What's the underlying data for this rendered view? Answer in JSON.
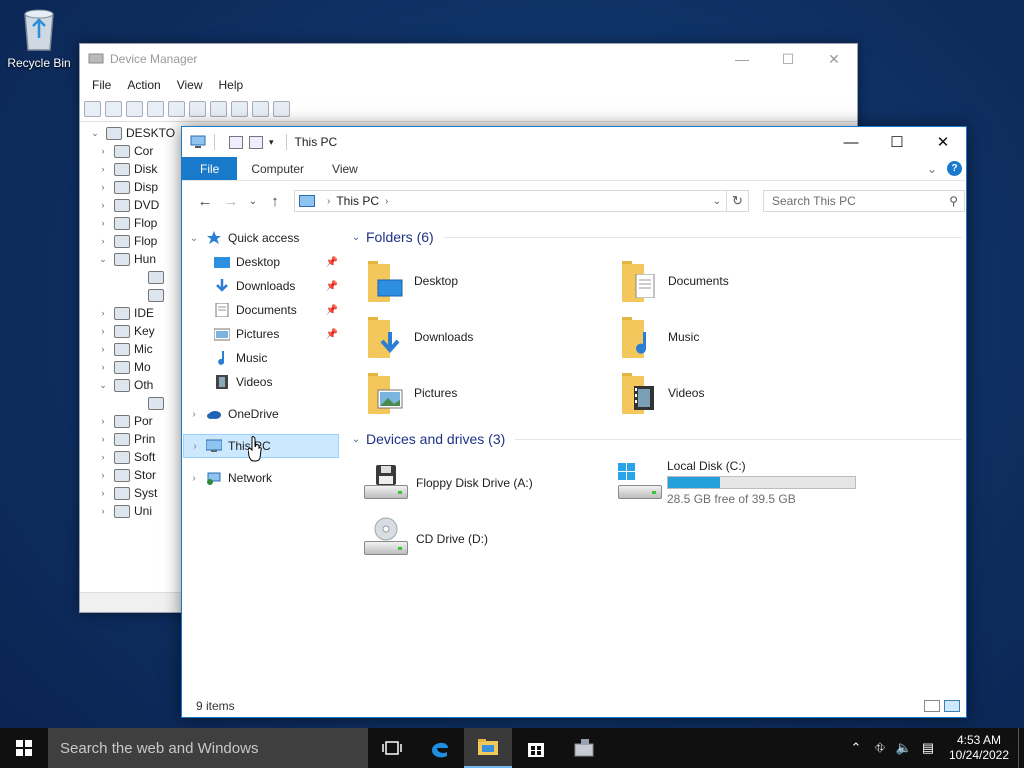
{
  "desktop": {
    "recycle_bin_label": "Recycle Bin"
  },
  "device_manager": {
    "title": "Device Manager",
    "menu": [
      "File",
      "Action",
      "View",
      "Help"
    ],
    "controls": {
      "minimize": "—",
      "maximize": "☐",
      "close": "✕"
    },
    "tree": [
      {
        "chev": "⌄",
        "label": "DESKTO"
      },
      {
        "chev": "›",
        "label": "Cor"
      },
      {
        "chev": "›",
        "label": "Disk"
      },
      {
        "chev": "›",
        "label": "Disp"
      },
      {
        "chev": "›",
        "label": "DVD"
      },
      {
        "chev": "›",
        "label": "Flop"
      },
      {
        "chev": "›",
        "label": "Flop"
      },
      {
        "chev": "⌄",
        "label": "Hun"
      },
      {
        "chev": "",
        "label": ""
      },
      {
        "chev": "",
        "label": ""
      },
      {
        "chev": "›",
        "label": "IDE"
      },
      {
        "chev": "›",
        "label": "Key"
      },
      {
        "chev": "›",
        "label": "Mic"
      },
      {
        "chev": "›",
        "label": "Mo"
      },
      {
        "chev": "⌄",
        "label": "Oth"
      },
      {
        "chev": "",
        "label": ""
      },
      {
        "chev": "›",
        "label": "Por"
      },
      {
        "chev": "›",
        "label": "Prin"
      },
      {
        "chev": "›",
        "label": "Soft"
      },
      {
        "chev": "›",
        "label": "Stor"
      },
      {
        "chev": "›",
        "label": "Syst"
      },
      {
        "chev": "›",
        "label": "Uni"
      }
    ]
  },
  "explorer": {
    "title": "This PC",
    "controls": {
      "minimize": "—",
      "maximize": "☐",
      "close": "✕"
    },
    "ribbon": {
      "file": "File",
      "computer": "Computer",
      "view": "View",
      "expand": "⌄",
      "help": "?"
    },
    "nav": {
      "back": "←",
      "forward": "→",
      "recent": "⌄",
      "up": "↑"
    },
    "address": {
      "crumb": "This PC",
      "sep": "›",
      "dropdown": "⌄",
      "refresh": "↻"
    },
    "search": {
      "placeholder": "Search This PC",
      "icon": "⚲"
    },
    "nav_pane": {
      "quick_access": "Quick access",
      "quick_items": [
        {
          "label": "Desktop",
          "pinned": true,
          "icon": "desktop-icon"
        },
        {
          "label": "Downloads",
          "pinned": true,
          "icon": "downloads-icon"
        },
        {
          "label": "Documents",
          "pinned": true,
          "icon": "documents-icon"
        },
        {
          "label": "Pictures",
          "pinned": true,
          "icon": "pictures-icon"
        },
        {
          "label": "Music",
          "pinned": false,
          "icon": "music-icon"
        },
        {
          "label": "Videos",
          "pinned": false,
          "icon": "videos-icon"
        }
      ],
      "onedrive": "OneDrive",
      "this_pc": "This PC",
      "network": "Network"
    },
    "folders_header": "Folders (6)",
    "folders": [
      {
        "label": "Desktop",
        "overlay": "desktop"
      },
      {
        "label": "Documents",
        "overlay": "documents"
      },
      {
        "label": "Downloads",
        "overlay": "downloads"
      },
      {
        "label": "Music",
        "overlay": "music"
      },
      {
        "label": "Pictures",
        "overlay": "pictures"
      },
      {
        "label": "Videos",
        "overlay": "videos"
      }
    ],
    "drives_header": "Devices and drives (3)",
    "drives": [
      {
        "label": "Floppy Disk Drive (A:)",
        "kind": "floppy"
      },
      {
        "label": "Local Disk (C:)",
        "kind": "hdd",
        "free_text": "28.5 GB free of 39.5 GB",
        "used_fraction": 0.278
      },
      {
        "label": "CD Drive (D:)",
        "kind": "cd"
      }
    ],
    "status": "9 items"
  },
  "taskbar": {
    "search_placeholder": "Search the web and Windows",
    "time": "4:53 AM",
    "date": "10/24/2022",
    "tray": {
      "chevron": "⌃",
      "network": "⛗",
      "volume": "🔈",
      "notifications": "▤"
    }
  },
  "colors": {
    "accent": "#1979ca",
    "folder": "#f3c75b",
    "selection": "#cce8ff",
    "bar_fill": "#26a0da"
  }
}
